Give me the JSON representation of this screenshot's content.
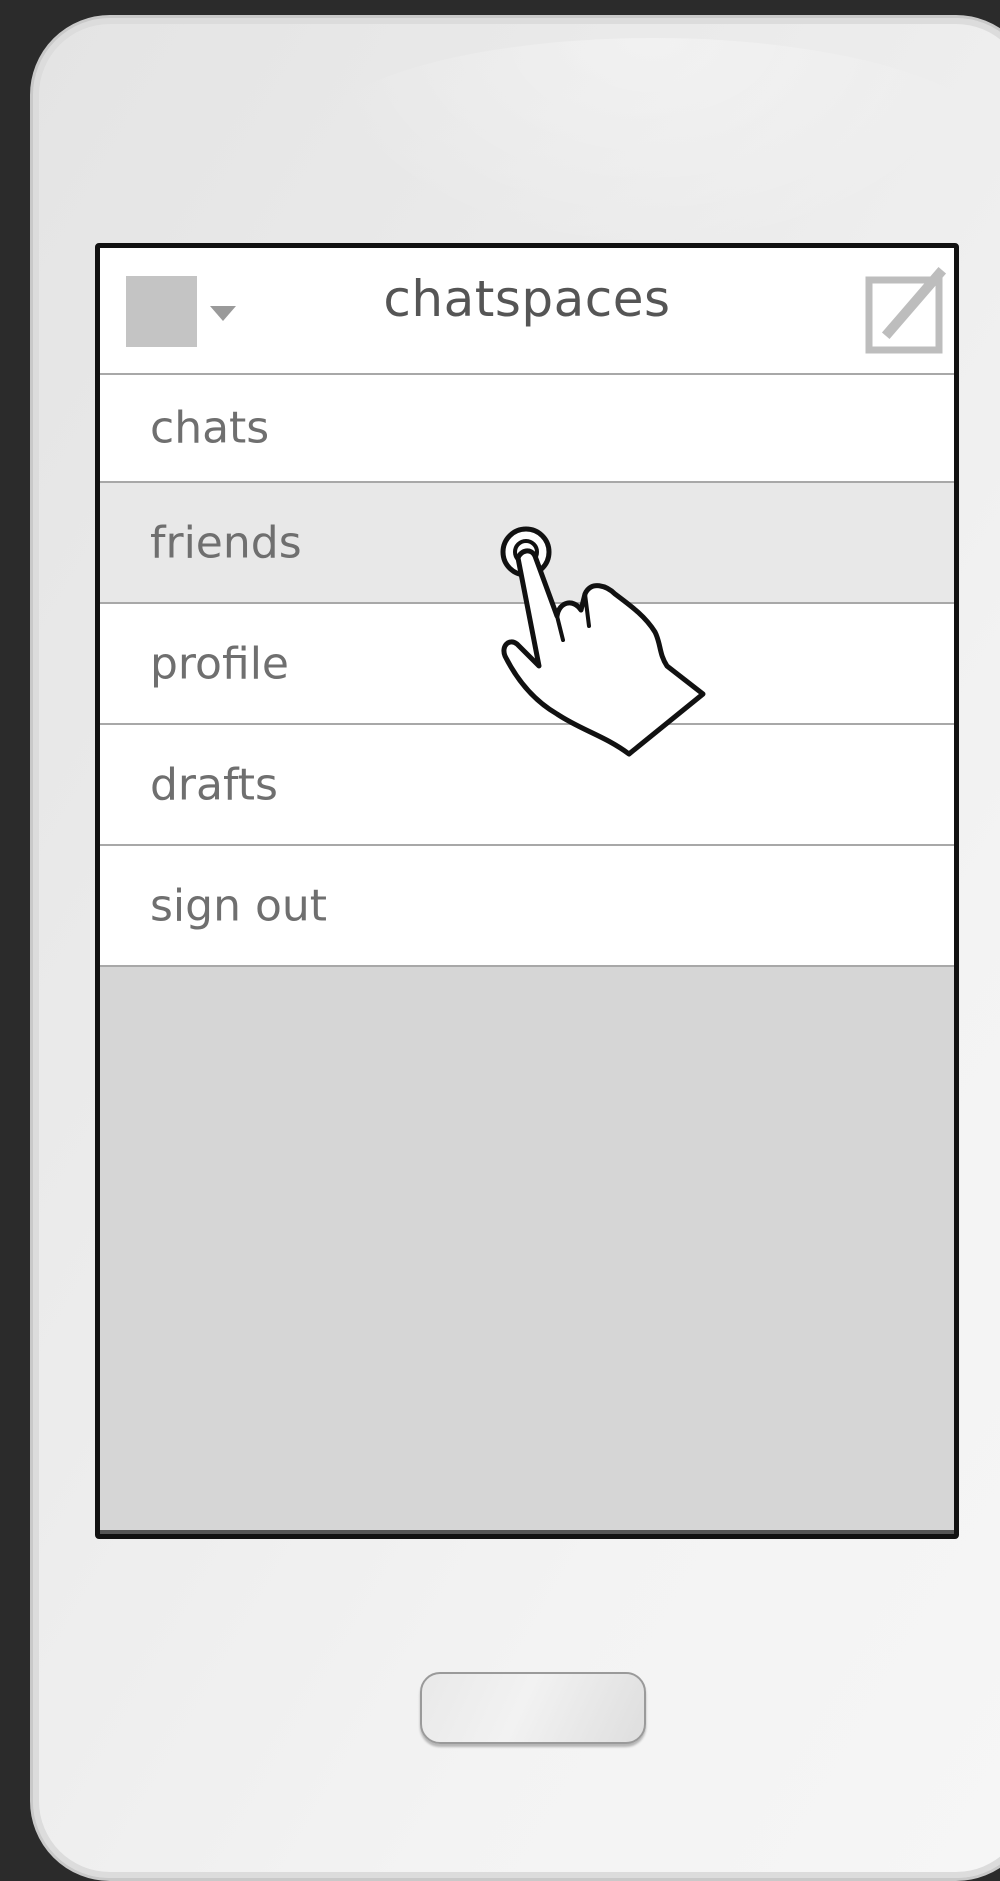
{
  "app": {
    "title": "chatspaces"
  },
  "header": {
    "app_icon": "app-icon-placeholder",
    "menu_icon": "dropdown-arrow-icon",
    "compose_icon": "compose-icon"
  },
  "menu": {
    "items": [
      {
        "label": "chats",
        "state": "normal"
      },
      {
        "label": "friends",
        "state": "pressed"
      },
      {
        "label": "profile",
        "state": "normal"
      },
      {
        "label": "drafts",
        "state": "normal"
      },
      {
        "label": "sign out",
        "state": "normal"
      }
    ]
  },
  "gesture": {
    "icon": "tap-hand-icon",
    "target": "friends"
  },
  "colors": {
    "pressed_row": "#e8e8e8",
    "screen_background": "#d6d6d6",
    "text": "#6f6f6f"
  }
}
